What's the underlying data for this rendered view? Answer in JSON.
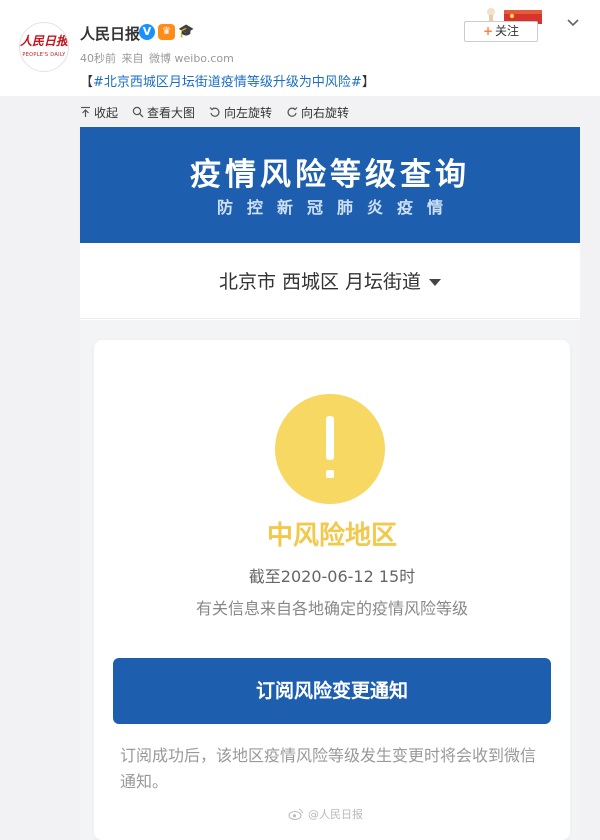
{
  "post": {
    "avatar_text": "人民日报",
    "avatar_sub": "PEOPLE'S DAILY",
    "username": "人民日报",
    "verified_badge": "V",
    "crown_badge": "♛",
    "cap_badge": "🎓",
    "time": "40秒前",
    "source_prefix": "来自",
    "source": "微博 weibo.com",
    "text_open": "【",
    "topic": "#北京西城区月坛街道疫情等级升级为中风险#",
    "text_close": "】",
    "follow_label": "关注",
    "follow_plus": "+",
    "menu_icon": "chevron-down-icon"
  },
  "toolbar": {
    "collapse": "收起",
    "view_large": "查看大图",
    "rotate_left": "向左旋转",
    "rotate_right": "向右旋转"
  },
  "screenshot": {
    "banner_title": "疫情风险等级查询",
    "banner_subtitle": "防控新冠肺炎疫情",
    "location": "北京市  西城区  月坛街道",
    "risk_level": "中风险地区",
    "as_of": "截至2020-06-12 15时",
    "source_note": "有关信息来自各地确定的疫情风险等级",
    "subscribe_button": "订阅风险变更通知",
    "subscribe_note": "订阅成功后，该地区疫情风险等级发生变更时将会收到微信通知。"
  },
  "watermark": "@人民日报",
  "colors": {
    "banner_blue": "#1d5fae",
    "warning_yellow": "#f6d863",
    "risk_text_yellow": "#f2c94c",
    "topic_blue": "#1a6fc4",
    "page_gray": "#f2f2f5"
  }
}
